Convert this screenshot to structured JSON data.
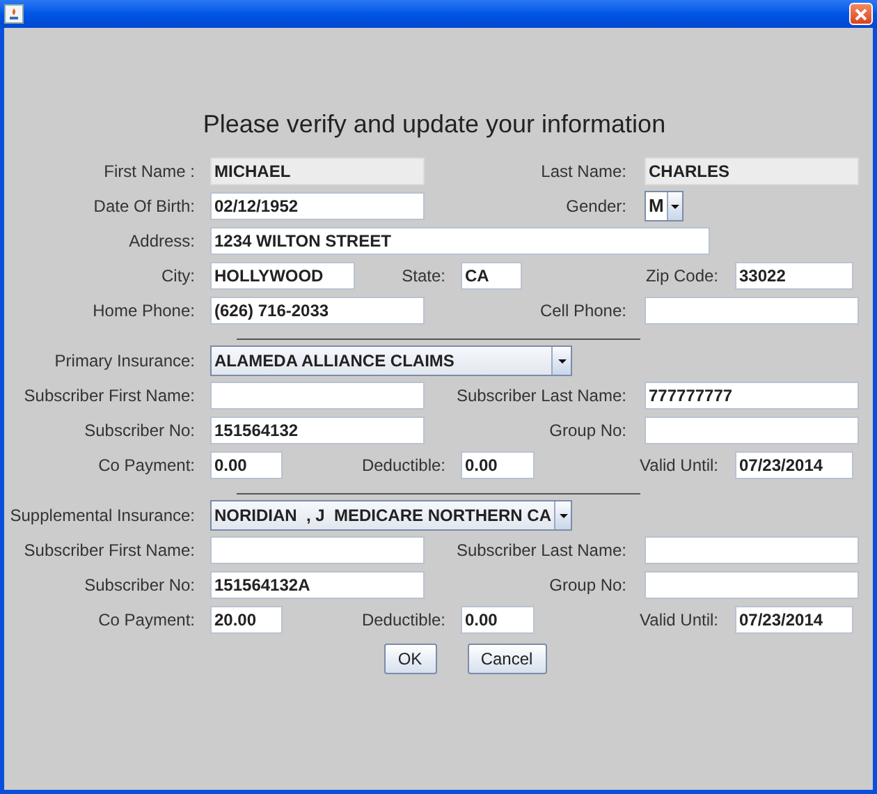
{
  "heading": "Please verify and update your information",
  "sections": [
    {
      "rows": [
        {
          "kind": "pair",
          "items": [
            {
              "kind": "text",
              "label": "First Name :",
              "value": "MICHAEL",
              "editable": false
            },
            {
              "kind": "text",
              "label": "Last Name:",
              "value": "CHARLES",
              "editable": false
            }
          ]
        },
        {
          "kind": "pair",
          "items": [
            {
              "kind": "text",
              "label": "Date Of Birth:",
              "value": "02/12/1952",
              "editable": true
            },
            {
              "kind": "dropdown",
              "label": "Gender:",
              "value": "M"
            }
          ]
        },
        {
          "kind": "wide",
          "items": [
            {
              "kind": "text",
              "label": "Address:",
              "value": "1234 WILTON STREET",
              "editable": true
            }
          ]
        },
        {
          "kind": "triple",
          "items": [
            {
              "kind": "text",
              "label": "City:",
              "value": "HOLLYWOOD",
              "editable": true
            },
            {
              "kind": "text",
              "label": "State:",
              "value": "CA",
              "editable": true
            },
            {
              "kind": "text",
              "label": "Zip Code:",
              "value": "33022",
              "editable": true
            }
          ]
        },
        {
          "kind": "pair",
          "items": [
            {
              "kind": "text",
              "label": "Home Phone:",
              "value": "(626) 716-2033",
              "editable": true
            },
            {
              "kind": "text",
              "label": "Cell Phone:",
              "editable": true
            }
          ]
        }
      ]
    },
    {
      "rows": [
        {
          "kind": "combo",
          "items": [
            {
              "kind": "dropdown",
              "label": "Primary Insurance:",
              "value": "ALAMEDA ALLIANCE CLAIMS"
            }
          ]
        },
        {
          "kind": "pair",
          "items": [
            {
              "kind": "text",
              "label": "Subscriber First Name:",
              "editable": true
            },
            {
              "kind": "text",
              "label": "Subscriber Last Name:",
              "value": "777777777",
              "editable": true
            }
          ]
        },
        {
          "kind": "pair",
          "items": [
            {
              "kind": "text",
              "label": "Subscriber No:",
              "value": "151564132",
              "editable": true
            },
            {
              "kind": "text",
              "label": "Group No:",
              "editable": true
            }
          ]
        },
        {
          "kind": "amounts",
          "items": [
            {
              "kind": "text",
              "label": "Co Payment:",
              "value": "0.00",
              "editable": true
            },
            {
              "kind": "text",
              "label": "Deductible:",
              "value": "0.00",
              "editable": true
            },
            {
              "kind": "text",
              "label": "Valid Until:",
              "value": "07/23/2014",
              "editable": true
            }
          ]
        }
      ]
    },
    {
      "rows": [
        {
          "kind": "combo",
          "items": [
            {
              "kind": "dropdown",
              "label": "Supplemental Insurance:",
              "value": "NORIDIAN  , J  MEDICARE NORTHERN CA"
            }
          ]
        },
        {
          "kind": "pair",
          "items": [
            {
              "kind": "text",
              "label": "Subscriber First Name:",
              "editable": true
            },
            {
              "kind": "text",
              "label": "Subscriber Last Name:",
              "editable": true
            }
          ]
        },
        {
          "kind": "pair",
          "items": [
            {
              "kind": "text",
              "label": "Subscriber No:",
              "value": "151564132A",
              "editable": true
            },
            {
              "kind": "text",
              "label": "Group No:",
              "editable": true
            }
          ]
        },
        {
          "kind": "amounts",
          "items": [
            {
              "kind": "text",
              "label": "Co Payment:",
              "value": "20.00",
              "editable": true
            },
            {
              "kind": "text",
              "label": "Deductible:",
              "value": "0.00",
              "editable": true
            },
            {
              "kind": "text",
              "label": "Valid Until:",
              "value": "07/23/2014",
              "editable": true
            }
          ]
        }
      ]
    }
  ],
  "buttons": [
    {
      "label": "OK"
    },
    {
      "label": "Cancel"
    }
  ]
}
